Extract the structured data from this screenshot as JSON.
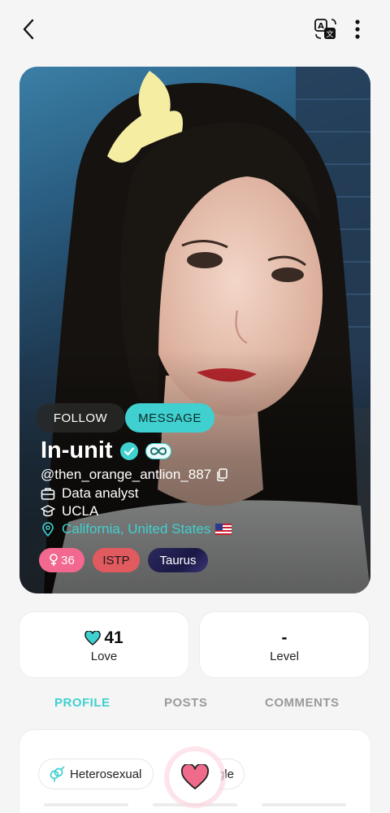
{
  "colors": {
    "accent": "#3fd0cf",
    "pink": "#f2688f",
    "red": "#e05a5f",
    "inactive_tab": "#9a9a9a"
  },
  "header": {
    "back_icon": "chevron-left-icon",
    "translate_icon": "translate-icon",
    "more_icon": "more-vertical-icon"
  },
  "profile": {
    "follow_label": "FOLLOW",
    "message_label": "MESSAGE",
    "name": "In-unit",
    "handle": "@then_orange_antlion_887",
    "occupation": "Data analyst",
    "school": "UCLA",
    "location": "California, United States",
    "tags": {
      "age": "36",
      "mbti": "ISTP",
      "zodiac": "Taurus"
    }
  },
  "stats": {
    "love_value": "41",
    "love_label": "Love",
    "level_value": "-",
    "level_label": "Level"
  },
  "tabs": {
    "profile": "PROFILE",
    "posts": "POSTS",
    "comments": "COMMENTS",
    "active": "PROFILE"
  },
  "details": {
    "orientation": "Heterosexual",
    "status_partial": "gle"
  }
}
